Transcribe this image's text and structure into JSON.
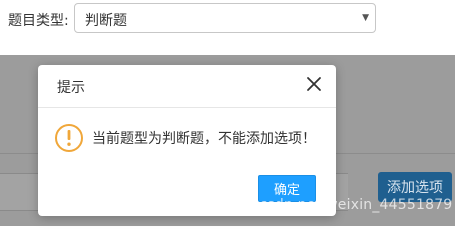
{
  "form": {
    "type_label": "题目类型:",
    "type_select_value": "判断题"
  },
  "background": {
    "add_option_label": "添加选项"
  },
  "dialog": {
    "title": "提示",
    "message": "当前题型为判断题，不能添加选项！",
    "confirm_label": "确定",
    "icon": "warning-icon",
    "close_icon": "close-icon"
  },
  "watermark": {
    "text": "https://blog.csdn.net/weixin_44551879"
  },
  "colors": {
    "accent": "#1e9fff",
    "warning": "#f0a73a",
    "overlay": "#9c9c9c"
  }
}
